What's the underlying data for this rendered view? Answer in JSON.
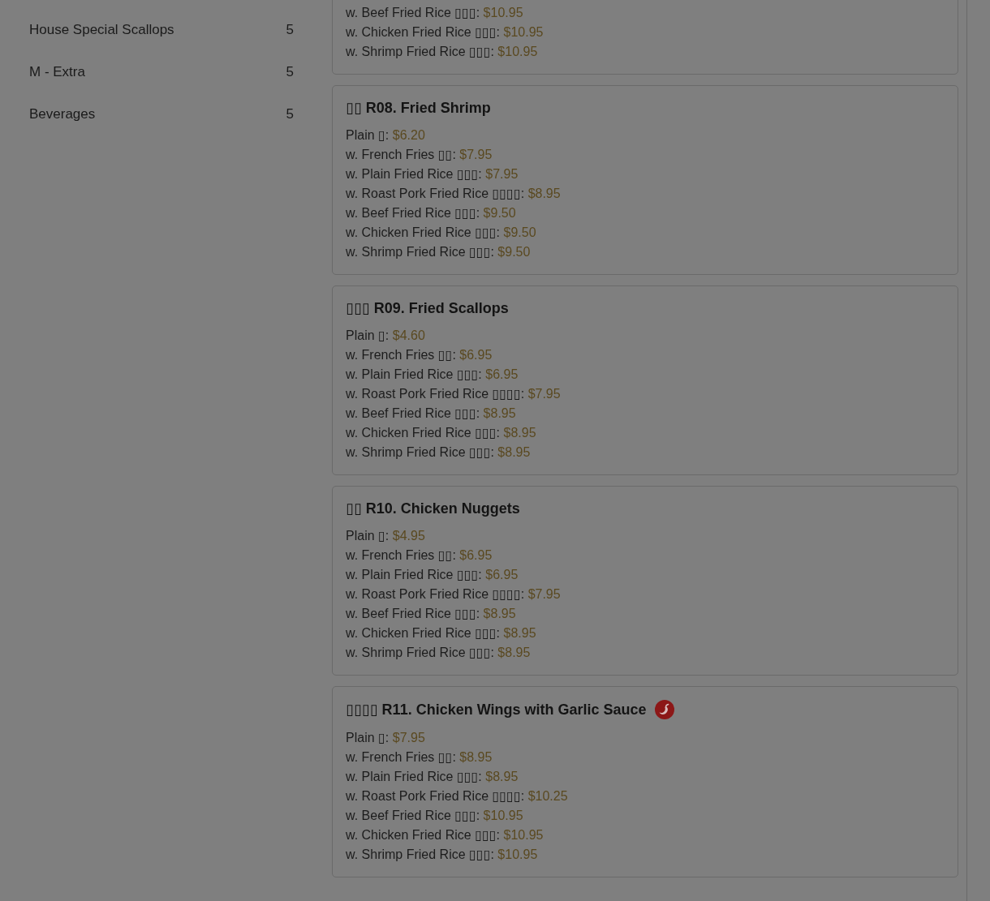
{
  "sidebar": {
    "categories": [
      {
        "name": "House Special Scallops",
        "count": "5"
      },
      {
        "name": "M - Extra",
        "count": "5"
      },
      {
        "name": "Beverages",
        "count": "5"
      }
    ]
  },
  "menu": {
    "cards": [
      {
        "spicy": false,
        "options": [
          {
            "label": "w. Beef Fried Rice ▯▯▯:",
            "price": "$10.95"
          },
          {
            "label": "w. Chicken Fried Rice ▯▯▯:",
            "price": "$10.95"
          },
          {
            "label": "w. Shrimp Fried Rice ▯▯▯:",
            "price": "$10.95"
          }
        ]
      },
      {
        "title": "▯▯ R08. Fried Shrimp",
        "spicy": false,
        "options": [
          {
            "label": "Plain ▯:",
            "price": "$6.20"
          },
          {
            "label": "w. French Fries ▯▯:",
            "price": "$7.95"
          },
          {
            "label": "w. Plain Fried Rice ▯▯▯:",
            "price": "$7.95"
          },
          {
            "label": "w. Roast Pork Fried Rice ▯▯▯▯:",
            "price": "$8.95"
          },
          {
            "label": "w. Beef Fried Rice ▯▯▯:",
            "price": "$9.50"
          },
          {
            "label": "w. Chicken Fried Rice ▯▯▯:",
            "price": "$9.50"
          },
          {
            "label": "w. Shrimp Fried Rice ▯▯▯:",
            "price": "$9.50"
          }
        ]
      },
      {
        "title": "▯▯▯ R09. Fried Scallops",
        "spicy": false,
        "options": [
          {
            "label": "Plain ▯:",
            "price": "$4.60"
          },
          {
            "label": "w. French Fries ▯▯:",
            "price": "$6.95"
          },
          {
            "label": "w. Plain Fried Rice ▯▯▯:",
            "price": "$6.95"
          },
          {
            "label": "w. Roast Pork Fried Rice ▯▯▯▯:",
            "price": "$7.95"
          },
          {
            "label": "w. Beef Fried Rice ▯▯▯:",
            "price": "$8.95"
          },
          {
            "label": "w. Chicken Fried Rice ▯▯▯:",
            "price": "$8.95"
          },
          {
            "label": "w. Shrimp Fried Rice ▯▯▯:",
            "price": "$8.95"
          }
        ]
      },
      {
        "title": "▯▯ R10. Chicken Nuggets",
        "spicy": false,
        "options": [
          {
            "label": "Plain ▯:",
            "price": "$4.95"
          },
          {
            "label": "w. French Fries ▯▯:",
            "price": "$6.95"
          },
          {
            "label": "w. Plain Fried Rice ▯▯▯:",
            "price": "$6.95"
          },
          {
            "label": "w. Roast Pork Fried Rice ▯▯▯▯:",
            "price": "$7.95"
          },
          {
            "label": "w. Beef Fried Rice ▯▯▯:",
            "price": "$8.95"
          },
          {
            "label": "w. Chicken Fried Rice ▯▯▯:",
            "price": "$8.95"
          },
          {
            "label": "w. Shrimp Fried Rice ▯▯▯:",
            "price": "$8.95"
          }
        ]
      },
      {
        "title": "▯▯▯▯ R11. Chicken Wings with Garlic Sauce",
        "spicy": true,
        "options": [
          {
            "label": "Plain ▯:",
            "price": "$7.95"
          },
          {
            "label": "w. French Fries ▯▯:",
            "price": "$8.95"
          },
          {
            "label": "w. Plain Fried Rice ▯▯▯:",
            "price": "$8.95"
          },
          {
            "label": "w. Roast Pork Fried Rice ▯▯▯▯:",
            "price": "$10.25"
          },
          {
            "label": "w. Beef Fried Rice ▯▯▯:",
            "price": "$10.95"
          },
          {
            "label": "w. Chicken Fried Rice ▯▯▯:",
            "price": "$10.95"
          },
          {
            "label": "w. Shrimp Fried Rice ▯▯▯:",
            "price": "$10.95"
          }
        ]
      }
    ]
  }
}
